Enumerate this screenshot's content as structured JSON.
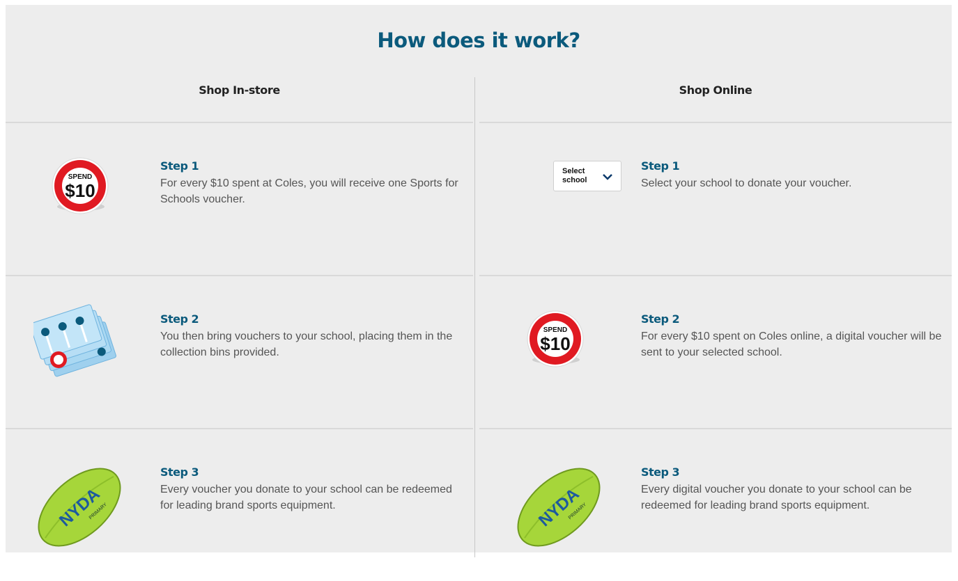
{
  "title": "How does it work?",
  "in_store": {
    "heading": "Shop In-store",
    "steps": [
      {
        "label": "Step 1",
        "desc": "For every $10 spent at Coles, you will receive one Sports for Schools voucher.",
        "icon": "spend-10-icon",
        "icon_text_top": "SPEND",
        "icon_text_main": "$10"
      },
      {
        "label": "Step 2",
        "desc": "You then bring vouchers to your school, placing them in the collection bins provided.",
        "icon": "vouchers-icon"
      },
      {
        "label": "Step 3",
        "desc": "Every voucher you donate to your school can be redeemed for leading brand sports equipment.",
        "icon": "football-icon",
        "icon_text_main": "NYDA",
        "icon_text_sub": "PRIMARY"
      }
    ]
  },
  "online": {
    "heading": "Shop Online",
    "select_school_text": "Select school",
    "steps": [
      {
        "label": "Step 1",
        "desc": "Select your school to donate your voucher.",
        "icon": "select-school-dropdown"
      },
      {
        "label": "Step 2",
        "desc": "For every $10 spent on Coles online, a digital voucher will be sent to your selected school.",
        "icon": "spend-10-icon",
        "icon_text_top": "SPEND",
        "icon_text_main": "$10"
      },
      {
        "label": "Step 3",
        "desc": "Every digital voucher you donate to your school can be redeemed for leading brand sports equipment.",
        "icon": "football-icon",
        "icon_text_main": "NYDA",
        "icon_text_sub": "PRIMARY"
      }
    ]
  },
  "colors": {
    "accent": "#0b5a7c",
    "background": "#ededed",
    "spend_red": "#e01a22",
    "ball_green": "#a6d63a"
  }
}
